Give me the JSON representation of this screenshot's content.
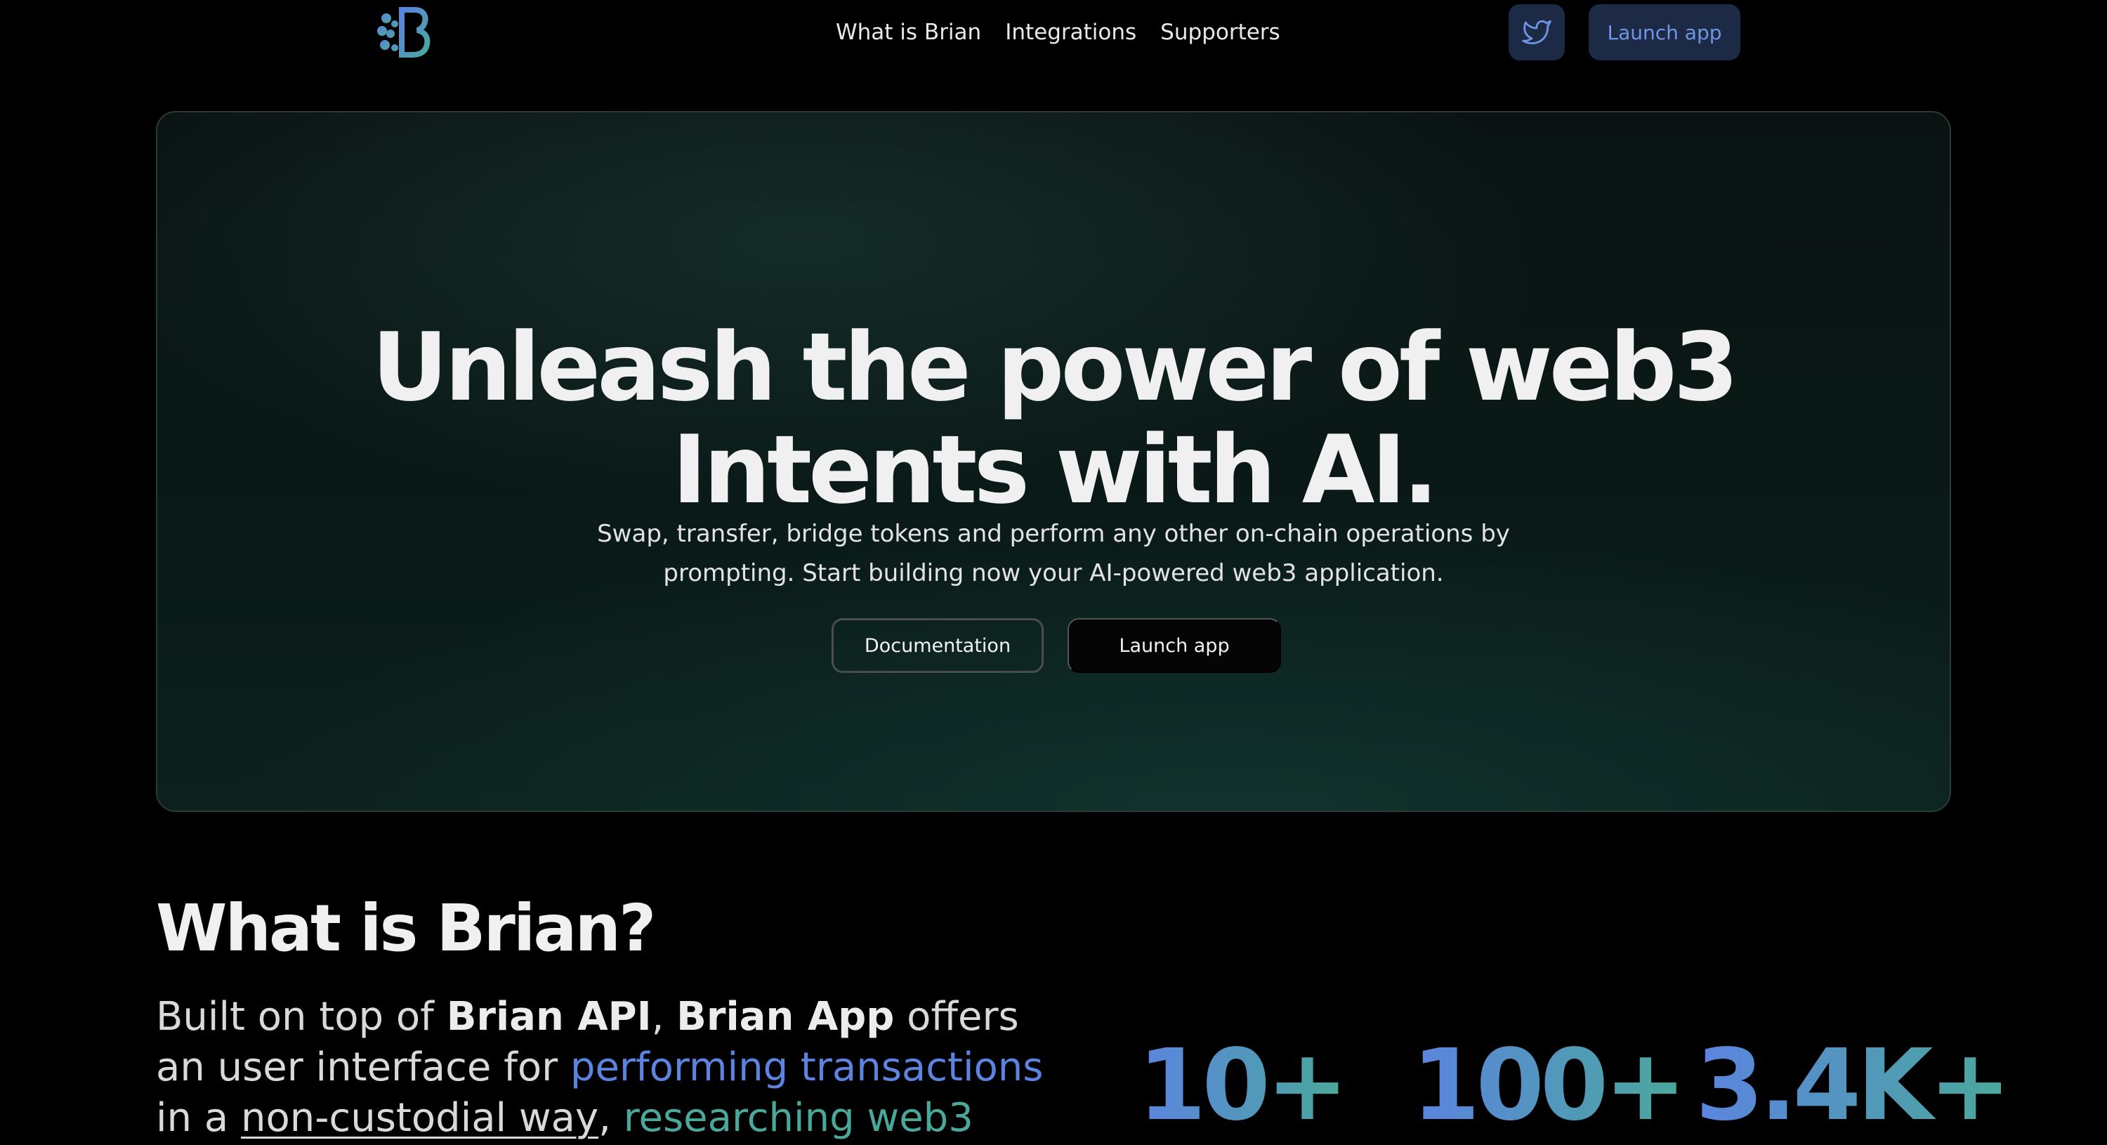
{
  "nav": {
    "links": [
      "What is Brian",
      "Integrations",
      "Supporters"
    ],
    "launch_label": "Launch app"
  },
  "hero": {
    "title_line1": "Unleash the power of web3",
    "title_line2": "Intents with AI.",
    "subtitle_line1": "Swap, transfer, bridge tokens and perform any other on-chain operations by",
    "subtitle_line2": "prompting. Start building now your AI-powered web3 application.",
    "docs_label": "Documentation",
    "launch_label": "Launch app"
  },
  "about": {
    "title": "What is Brian?",
    "desc_1": "Built on top of ",
    "desc_brian_api": "Brian API",
    "desc_2": ", ",
    "desc_brian_app": "Brian App",
    "desc_3": " offers an user interface for ",
    "desc_performing": "performing transactions",
    "desc_4": " in a ",
    "desc_noncustodial": "non-custodial way",
    "desc_5": ", ",
    "desc_researching": "researching web3"
  },
  "stats": [
    "10+",
    "100+",
    "3.4K+"
  ],
  "colors": {
    "accent_blue": "#5b84e0",
    "accent_teal": "#4aa89b",
    "nav_button_bg": "#1d2a45"
  },
  "icons": {
    "logo": "brain-b-logo-icon",
    "twitter": "twitter-icon"
  }
}
